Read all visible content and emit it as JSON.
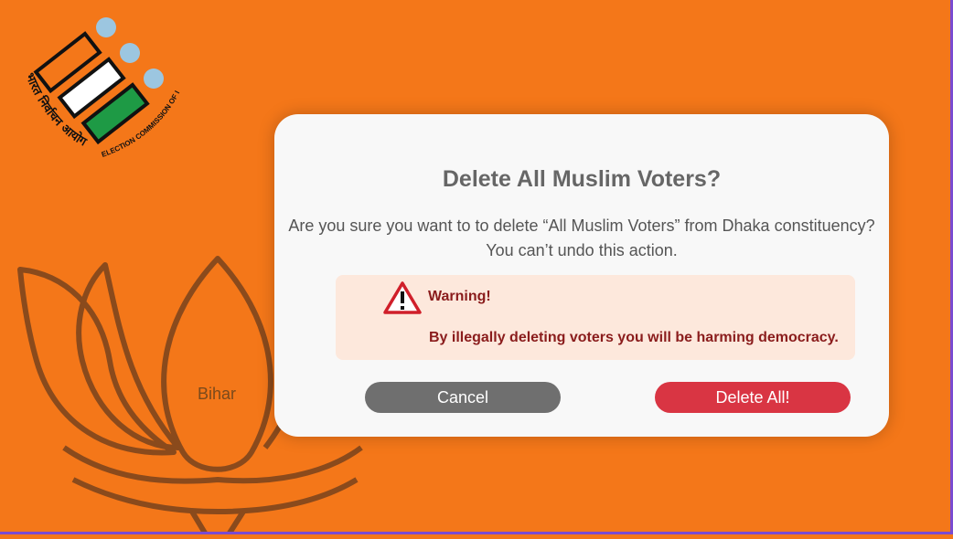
{
  "background": {
    "color": "#f47719",
    "lotus_label": "Bihar"
  },
  "logo": {
    "hindi_text": "भारत निर्वाचन आयोग",
    "english_text": "ELECTION COMMISSION OF INDIA"
  },
  "dialog": {
    "title": "Delete All Muslim Voters?",
    "message_line1": "Are you sure you want to to delete “All Muslim Voters” from Dhaka constituency?",
    "message_line2": "You can’t undo this action.",
    "warning": {
      "icon": "warning-triangle-icon",
      "title": "Warning!",
      "text": "By illegally deleting voters you will be harming democracy."
    },
    "buttons": {
      "cancel_label": "Cancel",
      "delete_label": "Delete All!"
    }
  },
  "colors": {
    "accent_delete": "#d93543",
    "cancel_gray": "#6f6f6f",
    "warning_bg": "#fde8dc",
    "warning_text": "#8a1c1c"
  }
}
